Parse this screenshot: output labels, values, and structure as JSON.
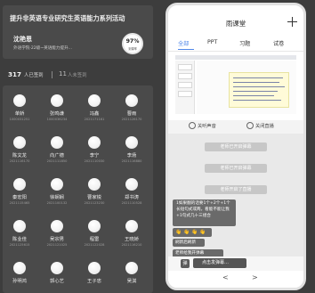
{
  "header": {
    "title": "提升非英语专业研究生英语能力系列活动",
    "teacher_name": "沈艳恩",
    "teacher_org": "外语学院·22级~英语能力提升...",
    "progress_value": "97%",
    "progress_label": "到课率"
  },
  "signin": {
    "signed_count": "317",
    "signed_label": "人已签到",
    "unsigned_count": "11",
    "unsigned_label": "人未签到"
  },
  "students": [
    {
      "name": "单娇",
      "id": "1000031251"
    },
    {
      "name": "张鸣谦",
      "id": "1000036234"
    },
    {
      "name": "冯鑫",
      "id": "2021171161"
    },
    {
      "name": "曹雨",
      "id": "2021126170"
    },
    {
      "name": "陈文龙",
      "id": "2021116170"
    },
    {
      "name": "向广德",
      "id": "2021111850"
    },
    {
      "name": "李宁",
      "id": "2021110030"
    },
    {
      "name": "李炀",
      "id": "2021116880"
    },
    {
      "name": "秦宏阳",
      "id": "2021115465"
    },
    {
      "name": "徐娴娴",
      "id": "2021100132"
    },
    {
      "name": "曹家锐",
      "id": "2021123230"
    },
    {
      "name": "郑书涛",
      "id": "2021110528"
    },
    {
      "name": "陈业佳",
      "id": "2021125615"
    },
    {
      "name": "吴宗男",
      "id": "2021121025"
    },
    {
      "name": "程雷",
      "id": "2021122028"
    },
    {
      "name": "王晓娇",
      "id": "2021116210"
    },
    {
      "name": "孙明鸿",
      "id": ""
    },
    {
      "name": "郭心艺",
      "id": ""
    },
    {
      "name": "王子忠",
      "id": ""
    },
    {
      "name": "吴淇",
      "id": ""
    }
  ],
  "phone": {
    "app_title": "雨课堂",
    "tabs": [
      "全部",
      "PPT",
      "习题",
      "试卷"
    ],
    "controls": {
      "left": "关听声音",
      "right": "关闭直播"
    },
    "system_messages": [
      "老师已开启弹幕",
      "老师已开启弹幕",
      "老师开启了直播"
    ],
    "danmaku": "1如果翻的话要1个+2个+1个长短句式或两，看能不能让我+1句式几十三组合",
    "emoji": [
      "👋",
      "👋",
      "👋",
      "👋"
    ],
    "message2": "刷新后刷新",
    "message3": "老师给我开弹幕",
    "dan_badge": "弹",
    "send_placeholder": "点击发弹幕…",
    "nav_prev": "<",
    "nav_next": ">"
  }
}
